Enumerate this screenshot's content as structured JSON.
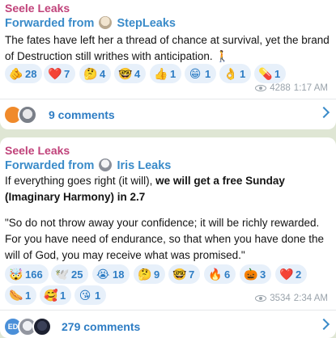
{
  "post1": {
    "channel": "Seele Leaks",
    "forwarded_label": "Forwarded from",
    "forwarded_source": "StepLeaks",
    "text": "The fates have left her a thread of chance at survival, yet the brand of Destruction still writhes with anticipation. 🚶",
    "reactions": [
      {
        "icon": "pointing-hand-emoji",
        "emoji": "🫵",
        "count": "28"
      },
      {
        "icon": "red-heart-emoji",
        "emoji": "❤️",
        "count": "7"
      },
      {
        "icon": "thinking-face-emoji",
        "emoji": "🤔",
        "count": "4"
      },
      {
        "icon": "nerd-face-emoji",
        "emoji": "🤓",
        "count": "4"
      },
      {
        "icon": "thumbs-up-emoji",
        "emoji": "👍",
        "count": "1"
      },
      {
        "icon": "grinning-face-emoji",
        "emoji": "😁",
        "count": "1"
      },
      {
        "icon": "ok-hand-emoji",
        "emoji": "👌",
        "count": "1"
      },
      {
        "icon": "pill-emoji",
        "emoji": "💊",
        "count": "1"
      }
    ],
    "views": "4288",
    "time": "1:17 AM",
    "comments": "9 comments"
  },
  "post2": {
    "channel": "Seele Leaks",
    "forwarded_label": "Forwarded from",
    "forwarded_source": "Iris Leaks",
    "line1_plain": "If everything goes right (it will), ",
    "line1_bold": "we will get a free Sunday (Imaginary Harmony) in 2.7",
    "quote": "\"So do not throw away your confidence; it will be richly rewarded. For you have need of endurance, so that when you have done the will of God, you may receive what was promised.\"",
    "reactions": [
      {
        "icon": "exploding-head-emoji",
        "emoji": "🤯",
        "count": "166"
      },
      {
        "icon": "dove-emoji",
        "emoji": "🕊️",
        "count": "25"
      },
      {
        "icon": "crying-face-emoji",
        "emoji": "😭",
        "count": "18"
      },
      {
        "icon": "thinking-face-emoji",
        "emoji": "🤔",
        "count": "9"
      },
      {
        "icon": "nerd-face-emoji",
        "emoji": "🤓",
        "count": "7"
      },
      {
        "icon": "fire-emoji",
        "emoji": "🔥",
        "count": "6"
      },
      {
        "icon": "jack-o-lantern-emoji",
        "emoji": "🎃",
        "count": "3"
      },
      {
        "icon": "red-heart-emoji",
        "emoji": "❤️",
        "count": "2"
      },
      {
        "icon": "hot-dog-emoji",
        "emoji": "🌭",
        "count": "1"
      },
      {
        "icon": "smiling-face-with-hearts-emoji",
        "emoji": "🥰",
        "count": "1"
      },
      {
        "icon": "face-blowing-kiss-emoji",
        "emoji": "😘",
        "count": "1"
      }
    ],
    "views": "3534",
    "time": "2:34 AM",
    "comments": "279 comments",
    "commenter_initials": "ED"
  },
  "colors": {
    "channel_name": "#c0427a",
    "link_blue": "#3a8bc9",
    "reaction_bg": "#e7f0fa",
    "reaction_text": "#2e7dc4",
    "chat_background": "#dfe6d4"
  }
}
